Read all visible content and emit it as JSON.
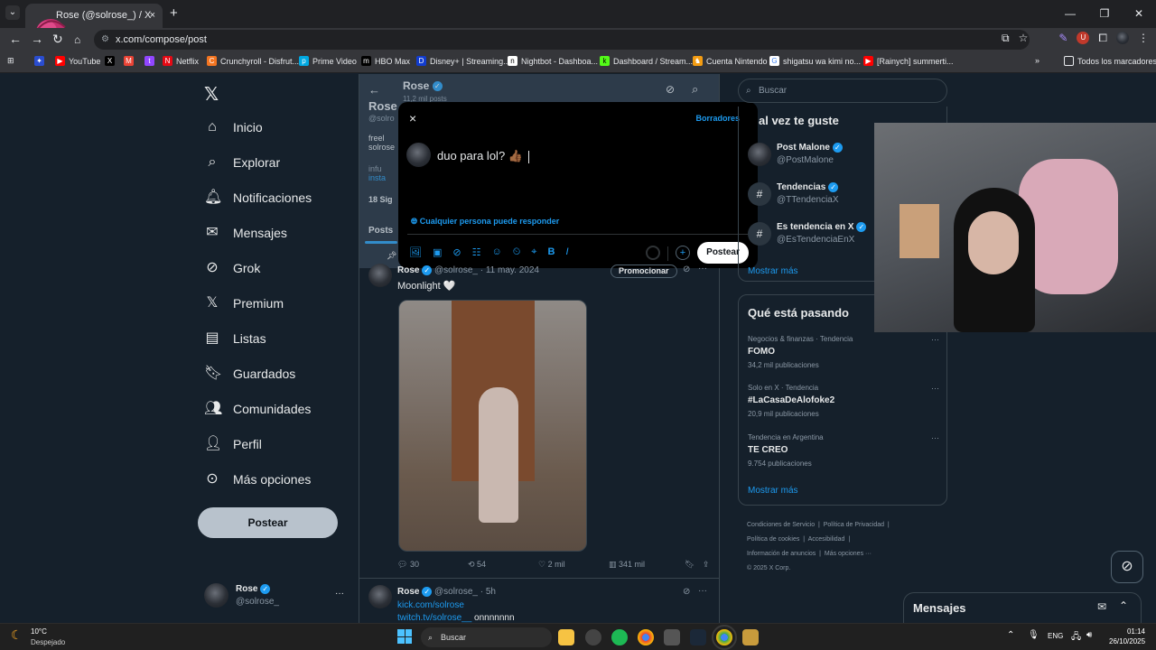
{
  "browser": {
    "tab_title": "Rose (@solrose_) / X",
    "tab_close": "×",
    "new_tab": "+",
    "url": "x.com/compose/post",
    "bookmarks": [
      "YouTube",
      "Netflix",
      "Crunchyroll - Disfrut...",
      "Prime Video",
      "HBO Max",
      "Disney+ | Streaming...",
      "Nightbot - Dashboa...",
      "Dashboard / Stream...",
      "Cuenta Nintendo",
      "shigatsu wa kimi no...",
      "[Rainych] summerti..."
    ],
    "bookmarks_folder": "Todos los marcadores",
    "more": "»"
  },
  "nav": {
    "items": [
      "Inicio",
      "Explorar",
      "Notificaciones",
      "Mensajes",
      "Grok",
      "Premium",
      "Listas",
      "Guardados",
      "Comunidades",
      "Perfil",
      "Más opciones"
    ],
    "icons": [
      "home-icon",
      "search-icon",
      "bell-icon",
      "mail-icon",
      "grok-icon",
      "x-logo-icon",
      "list-icon",
      "bookmark-icon",
      "communities-icon",
      "profile-icon",
      "more-circle-icon"
    ],
    "post_button": "Postear",
    "account_name": "Rose",
    "account_handle": "@solrose_",
    "account_more": "···"
  },
  "profile_header": {
    "name": "Rose",
    "posts_count": "11,2 mil posts",
    "handle_partial": "@solro",
    "bio_1": "freel",
    "bio_2": "solrose",
    "info_1": "infu",
    "info_2": "insta",
    "following": "18 Sig",
    "name_partial": "Rose"
  },
  "tabs": {
    "posts": "Posts"
  },
  "compose": {
    "close": "×",
    "drafts": "Borradores",
    "text": "duo para lol? 👍🏾",
    "reply_setting": "Cualquier persona puede responder",
    "post_button": "Postear",
    "add": "+"
  },
  "post1": {
    "name": "Rose",
    "meta": "@solrose_ · 11 may. 2024",
    "promote": "Promocionar",
    "text": "Moonlight 🤍",
    "replies": "30",
    "reposts": "54",
    "likes": "2 mil",
    "views": "341 mil"
  },
  "post2": {
    "name": "Rose",
    "meta": "@solrose_ · 5h",
    "link1": "kick.com/solrose",
    "link2": "twitch.tv/solrose__",
    "text_tail": "onnnnnnn"
  },
  "right": {
    "search_placeholder": "Buscar",
    "suggest_title": "al vez te guste",
    "suggestions": [
      {
        "name": "Post Malone",
        "handle": "@PostMalone"
      },
      {
        "name": "Tendencias",
        "handle": "@TTendenciaX"
      },
      {
        "name": "Es tendencia en X",
        "handle": "@EsTendenciaEnX"
      }
    ],
    "show_more_1": "Mostrar más",
    "trends_title": "Qué está pasando",
    "trends": [
      {
        "context": "Negocios & finanzas · Tendencia",
        "name": "FOMO",
        "count": "34,2 mil publicaciones"
      },
      {
        "context": "Solo en X · Tendencia",
        "name": "#LaCasaDeAlofoke2",
        "count": "20,9 mil publicaciones"
      },
      {
        "context": "Tendencia en Argentina",
        "name": "TE CREO",
        "count": "9.754 publicaciones"
      }
    ],
    "show_more_2": "Mostrar más",
    "footer": [
      "Condiciones de Servicio",
      "Política de Privacidad",
      "Política de cookies",
      "Accesibilidad",
      "Información de anuncios",
      "Más opciones ···",
      "© 2025 X Corp."
    ],
    "messages": "Mensajes"
  },
  "taskbar": {
    "weather_temp": "10°C",
    "weather_desc": "Despejado",
    "search": "Buscar",
    "lang": "ENG",
    "time": "01:14",
    "date": "26/10/2025"
  },
  "colors": {
    "bg": "#15202b",
    "accent": "#1d9bf0",
    "border": "#38444d"
  }
}
